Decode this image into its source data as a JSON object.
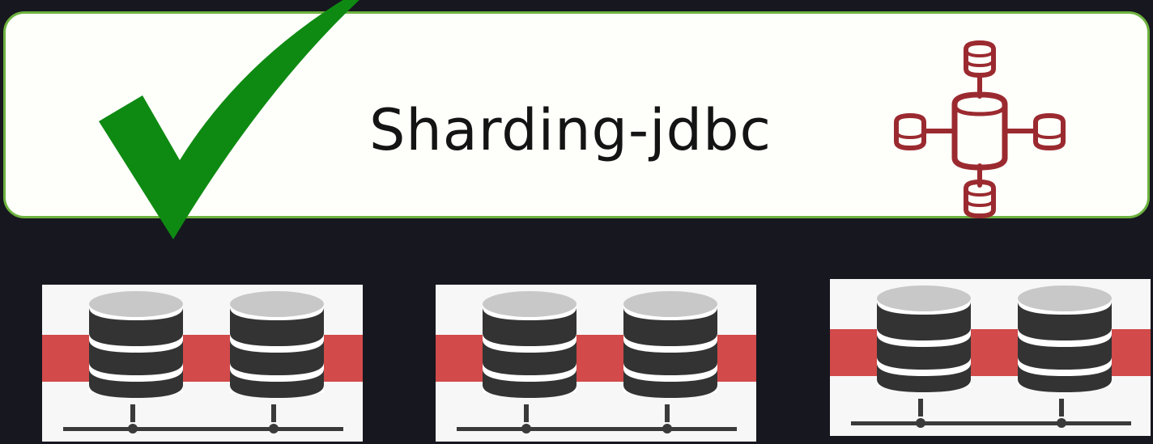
{
  "banner": {
    "title": "Sharding-jdbc",
    "logo_icon": "distributed-database-icon",
    "check_icon": "checkmark-icon"
  },
  "colors": {
    "background": "#17171f",
    "banner_fill": "#fefffa",
    "banner_border": "#6db23f",
    "checkmark": "#0e8a12",
    "logo": "#9b2a30",
    "node_band": "#d24a4a",
    "database": "#333333"
  },
  "database_nodes": [
    {
      "icon": "database-server-icon",
      "databases": 2
    },
    {
      "icon": "database-server-icon",
      "databases": 2
    },
    {
      "icon": "database-server-icon",
      "databases": 2
    }
  ]
}
